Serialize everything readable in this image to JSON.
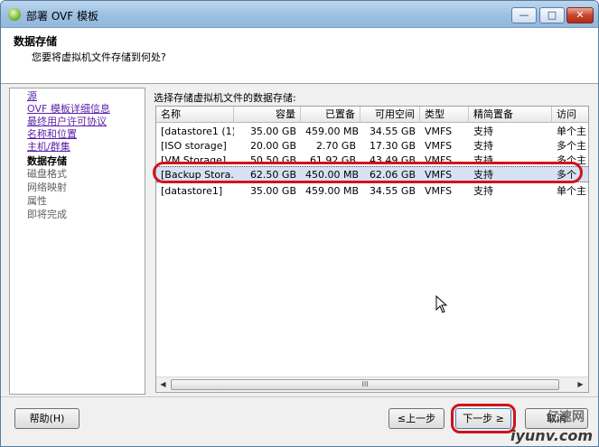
{
  "window": {
    "title": "部署 OVF 模板",
    "buttons": {
      "minimize": "—",
      "maximize": "□",
      "close": "✕"
    }
  },
  "header": {
    "title": "数据存储",
    "subtitle": "您要将虚拟机文件存储到何处?"
  },
  "nav": {
    "items": [
      {
        "label": "源",
        "state": "link"
      },
      {
        "label": "OVF 模板详细信息",
        "state": "link"
      },
      {
        "label": "最终用户许可协议",
        "state": "link"
      },
      {
        "label": "名称和位置",
        "state": "link"
      },
      {
        "label": "主机/群集",
        "state": "link"
      },
      {
        "label": "数据存储",
        "state": "current"
      },
      {
        "label": "磁盘格式",
        "state": "future"
      },
      {
        "label": "网络映射",
        "state": "future"
      },
      {
        "label": "属性",
        "state": "future"
      },
      {
        "label": "即将完成",
        "state": "future"
      }
    ]
  },
  "main": {
    "prompt": "选择存储虚拟机文件的数据存储:",
    "table": {
      "columns": [
        "名称",
        "容量",
        "已置备",
        "可用空间",
        "类型",
        "精简置备",
        "访问"
      ],
      "rows": [
        [
          "[datastore1 (1)]",
          "35.00 GB",
          "459.00 MB",
          "34.55 GB",
          "VMFS",
          "支持",
          "单个主"
        ],
        [
          "[ISO storage]",
          "20.00 GB",
          "2.70 GB",
          "17.30 GB",
          "VMFS",
          "支持",
          "多个主"
        ],
        [
          "[VM Storage]",
          "50.50 GB",
          "61.92 GB",
          "43.49 GB",
          "VMFS",
          "支持",
          "多个主"
        ],
        [
          "[Backup Stora...",
          "62.50 GB",
          "450.00 MB",
          "62.06 GB",
          "VMFS",
          "支持",
          "多个"
        ],
        [
          "[datastore1]",
          "35.00 GB",
          "459.00 MB",
          "34.55 GB",
          "VMFS",
          "支持",
          "单个主"
        ]
      ],
      "selected_row": 3
    },
    "scrollbar": {
      "left": "◀",
      "right": "▶",
      "grip": "III"
    }
  },
  "footer": {
    "help": "帮助(H)",
    "back": "≤上一步",
    "next": "下一步 ≥",
    "cancel": "取消"
  },
  "watermark": {
    "line1": "亿速网",
    "line2": "iyunv.com"
  },
  "colors": {
    "highlight": "#d0141b",
    "link": "#5a1fa8",
    "selection": "#d6e2f3"
  }
}
